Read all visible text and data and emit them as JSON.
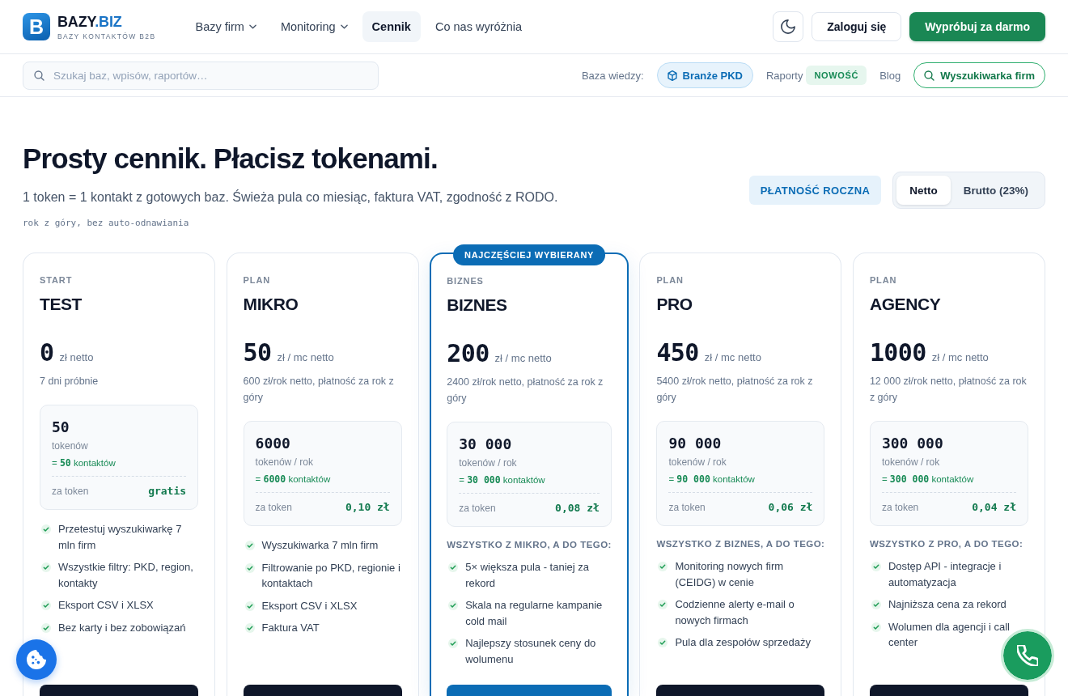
{
  "header": {
    "logo": {
      "letter": "B",
      "name": "BAZY",
      "accent": ".BIZ",
      "tagline": "BAZY KONTAKTÓW B2B"
    },
    "nav": [
      {
        "label": "Bazy firm",
        "dropdown": true,
        "selected": false
      },
      {
        "label": "Monitoring",
        "dropdown": true,
        "selected": false
      },
      {
        "label": "Cennik",
        "dropdown": false,
        "selected": true
      },
      {
        "label": "Co nas wyróżnia",
        "dropdown": false,
        "selected": false
      }
    ],
    "login": "Zaloguj się",
    "cta": "Wypróbuj za darmo"
  },
  "subbar": {
    "search": {
      "placeholder": "Szukaj baz, wpisów, raportów…"
    },
    "label": "Baza wiedzy:",
    "links": [
      {
        "kind": "pill",
        "label": "Branże PKD"
      },
      {
        "kind": "text",
        "label": "Raporty",
        "badge": "NOWOŚĆ"
      },
      {
        "kind": "text",
        "label": "Blog"
      },
      {
        "kind": "outline",
        "label": "Wyszukiwarka firm"
      }
    ]
  },
  "intro": {
    "title": "Prosty cennik. Płacisz tokenami.",
    "subtitle": "1 token = 1 kontakt z gotowych baz. Świeża pula co miesiąc, faktura VAT, zgodność z RODO.",
    "note": "rok z góry, bez auto-odnawiania",
    "billing": "PŁATNOŚĆ ROCZNA",
    "tax_toggle": [
      {
        "label": "Netto",
        "selected": true
      },
      {
        "label": "Brutto (23%)",
        "selected": false
      }
    ]
  },
  "plans": [
    {
      "featured": false,
      "label": "START",
      "name": "TEST",
      "price": "0",
      "unit": "zł netto",
      "note": "7 dni próbnie",
      "tokens": "50",
      "tokens_unit": "tokenów",
      "contacts": "= **50** kontaktów",
      "per_token_label": "za token",
      "per_token": "gratis",
      "features": [
        "Przetestuj wyszukiwarkę 7 mln firm",
        "Wszystkie filtry: PKD, region, kontakty",
        "Eksport CSV i XLSX",
        "Bez karty i bez zobowiązań"
      ]
    },
    {
      "featured": false,
      "label": "PLAN",
      "name": "MIKRO",
      "price": "50",
      "unit": "zł / mc netto",
      "note": "600 zł/rok netto, płatność za rok z góry",
      "tokens": "6000",
      "tokens_unit": "tokenów / rok",
      "contacts": "= **6000** kontaktów",
      "per_token_label": "za token",
      "per_token": "0,10 zł",
      "features": [
        "Wyszukiwarka 7 mln firm",
        "Filtrowanie po PKD, regionie i kontaktach",
        "Eksport CSV i XLSX",
        "Faktura VAT"
      ]
    },
    {
      "featured": true,
      "badge": "NAJCZĘŚCIEJ WYBIERANY",
      "label": "BIZNES",
      "name": "BIZNES",
      "price": "200",
      "unit": "zł / mc netto",
      "note": "2400 zł/rok netto, płatność za rok z góry",
      "tokens": "30 000",
      "tokens_unit": "tokenów / rok",
      "contacts": "= **30 000** kontaktów",
      "per_token_label": "za token",
      "per_token": "0,08 zł",
      "includes": "WSZYSTKO Z MIKRO, A DO TEGO:",
      "features": [
        "5× większa pula - taniej za rekord",
        "Skala na regularne kampanie cold mail",
        "Najlepszy stosunek ceny do wolumenu"
      ]
    },
    {
      "featured": false,
      "label": "PLAN",
      "name": "PRO",
      "price": "450",
      "unit": "zł / mc netto",
      "note": "5400 zł/rok netto, płatność za rok z góry",
      "tokens": "90 000",
      "tokens_unit": "tokenów / rok",
      "contacts": "= **90 000** kontaktów",
      "per_token_label": "za token",
      "per_token": "0,06 zł",
      "includes": "WSZYSTKO Z BIZNES, A DO TEGO:",
      "features": [
        "Monitoring nowych firm (CEIDG) w cenie",
        "Codzienne alerty e-mail o nowych firmach",
        "Pula dla zespołów sprzedaży"
      ]
    },
    {
      "featured": false,
      "label": "PLAN",
      "name": "AGENCY",
      "price": "1000",
      "unit": "zł / mc netto",
      "note": "12 000 zł/rok netto, płatność za rok z góry",
      "tokens": "300 000",
      "tokens_unit": "tokenów / rok",
      "contacts": "= **300 000** kontaktów",
      "per_token_label": "za token",
      "per_token": "0,04 zł",
      "includes": "WSZYSTKO Z PRO, A DO TEGO:",
      "features": [
        "Dostęp API - integracje i automatyzacja",
        "Najniższa cena za rekord",
        "Wolumen dla agencji i call center"
      ]
    }
  ]
}
